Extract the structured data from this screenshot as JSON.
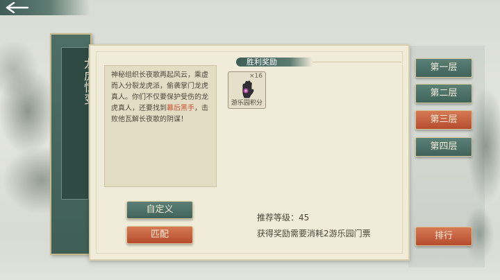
{
  "title": "龙虎惊变",
  "description": {
    "before": "神秘组织长夜歌再起风云，乘虚而入分裂龙虎派，偷袭掌门龙虎真人。你们不仅要保护受伤的龙虎真人，还要找到",
    "highlight": "幕后黑手",
    "after": "，击败他瓦解长夜歌的阴谋！"
  },
  "reward": {
    "title": "胜利奖励",
    "item": {
      "qty": "×16",
      "label": "游乐园积分",
      "icon": "glove-icon"
    }
  },
  "info": {
    "level": "推荐等级：45",
    "cost": "获得奖励需要消耗2游乐园门票"
  },
  "buttons": {
    "custom": "自定义",
    "match": "匹配",
    "rank": "排行"
  },
  "floors": [
    {
      "label": "第一层",
      "selected": false
    },
    {
      "label": "第二层",
      "selected": false
    },
    {
      "label": "第三层",
      "selected": true
    },
    {
      "label": "第四层",
      "selected": false
    }
  ],
  "colors": {
    "teal": "#406359",
    "red": "#b54c2e",
    "parchment": "#f1ecd9",
    "highlight": "#c4522f"
  }
}
